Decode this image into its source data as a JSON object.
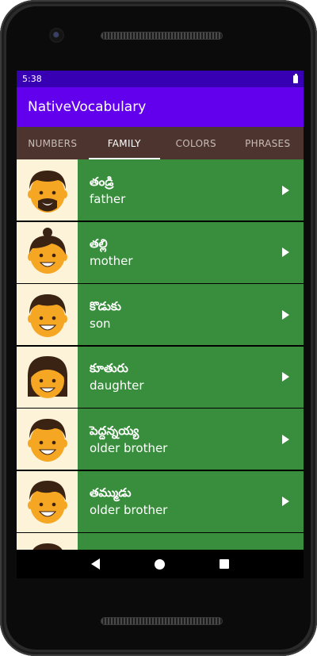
{
  "status": {
    "time": "5:38"
  },
  "app": {
    "title": "NativeVocabulary"
  },
  "tabs": [
    {
      "label": "NUMBERS"
    },
    {
      "label": "FAMILY"
    },
    {
      "label": "COLORS"
    },
    {
      "label": "PHRASES"
    }
  ],
  "words": [
    {
      "native": "తండ్రి",
      "english": "father"
    },
    {
      "native": "తల్లి",
      "english": "mother"
    },
    {
      "native": "కొడుకు",
      "english": "son"
    },
    {
      "native": "కూతురు",
      "english": "daughter"
    },
    {
      "native": "పెద్దన్నయ్య",
      "english": "older brother"
    },
    {
      "native": "తమ్ముడు",
      "english": "older brother"
    }
  ],
  "colors": {
    "status_bar": "#3700b3",
    "app_bar": "#6200ee",
    "tab_bar": "#4e342e",
    "row_bg": "#388e3c",
    "thumb_bg": "#fdf3d8"
  }
}
